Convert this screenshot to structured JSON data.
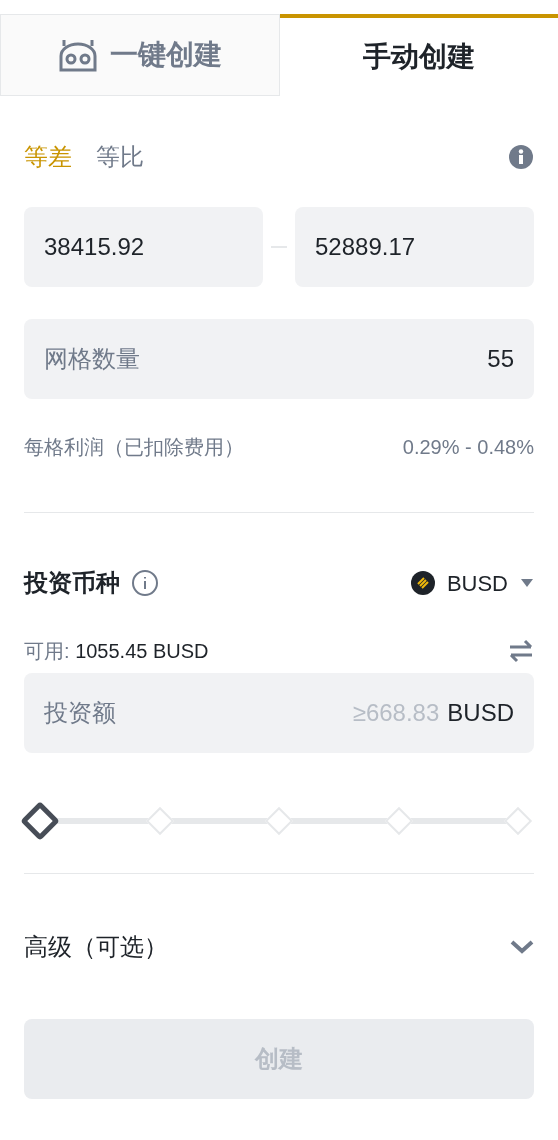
{
  "mode_tabs": [
    {
      "label": "一键创建",
      "selected": false
    },
    {
      "label": "手动创建",
      "selected": true
    }
  ],
  "grid_types": [
    {
      "label": "等差",
      "selected": true
    },
    {
      "label": "等比",
      "selected": false
    }
  ],
  "price_range": {
    "lower": "38415.92",
    "upper": "52889.17"
  },
  "grid_count": {
    "label": "网格数量",
    "value": "55"
  },
  "profit_per_grid": {
    "label": "每格利润（已扣除费用）",
    "value": "0.29% - 0.48%"
  },
  "investment": {
    "title": "投资币种",
    "currency": "BUSD",
    "available_label": "可用:",
    "available_value": "1055.45 BUSD",
    "amount_placeholder": "投资额",
    "minimum": "≥668.83",
    "unit": "BUSD"
  },
  "slider": {
    "level": 0
  },
  "advanced": {
    "label": "高级（可选）",
    "expanded": false
  },
  "create_button": {
    "label": "创建",
    "disabled": true
  }
}
